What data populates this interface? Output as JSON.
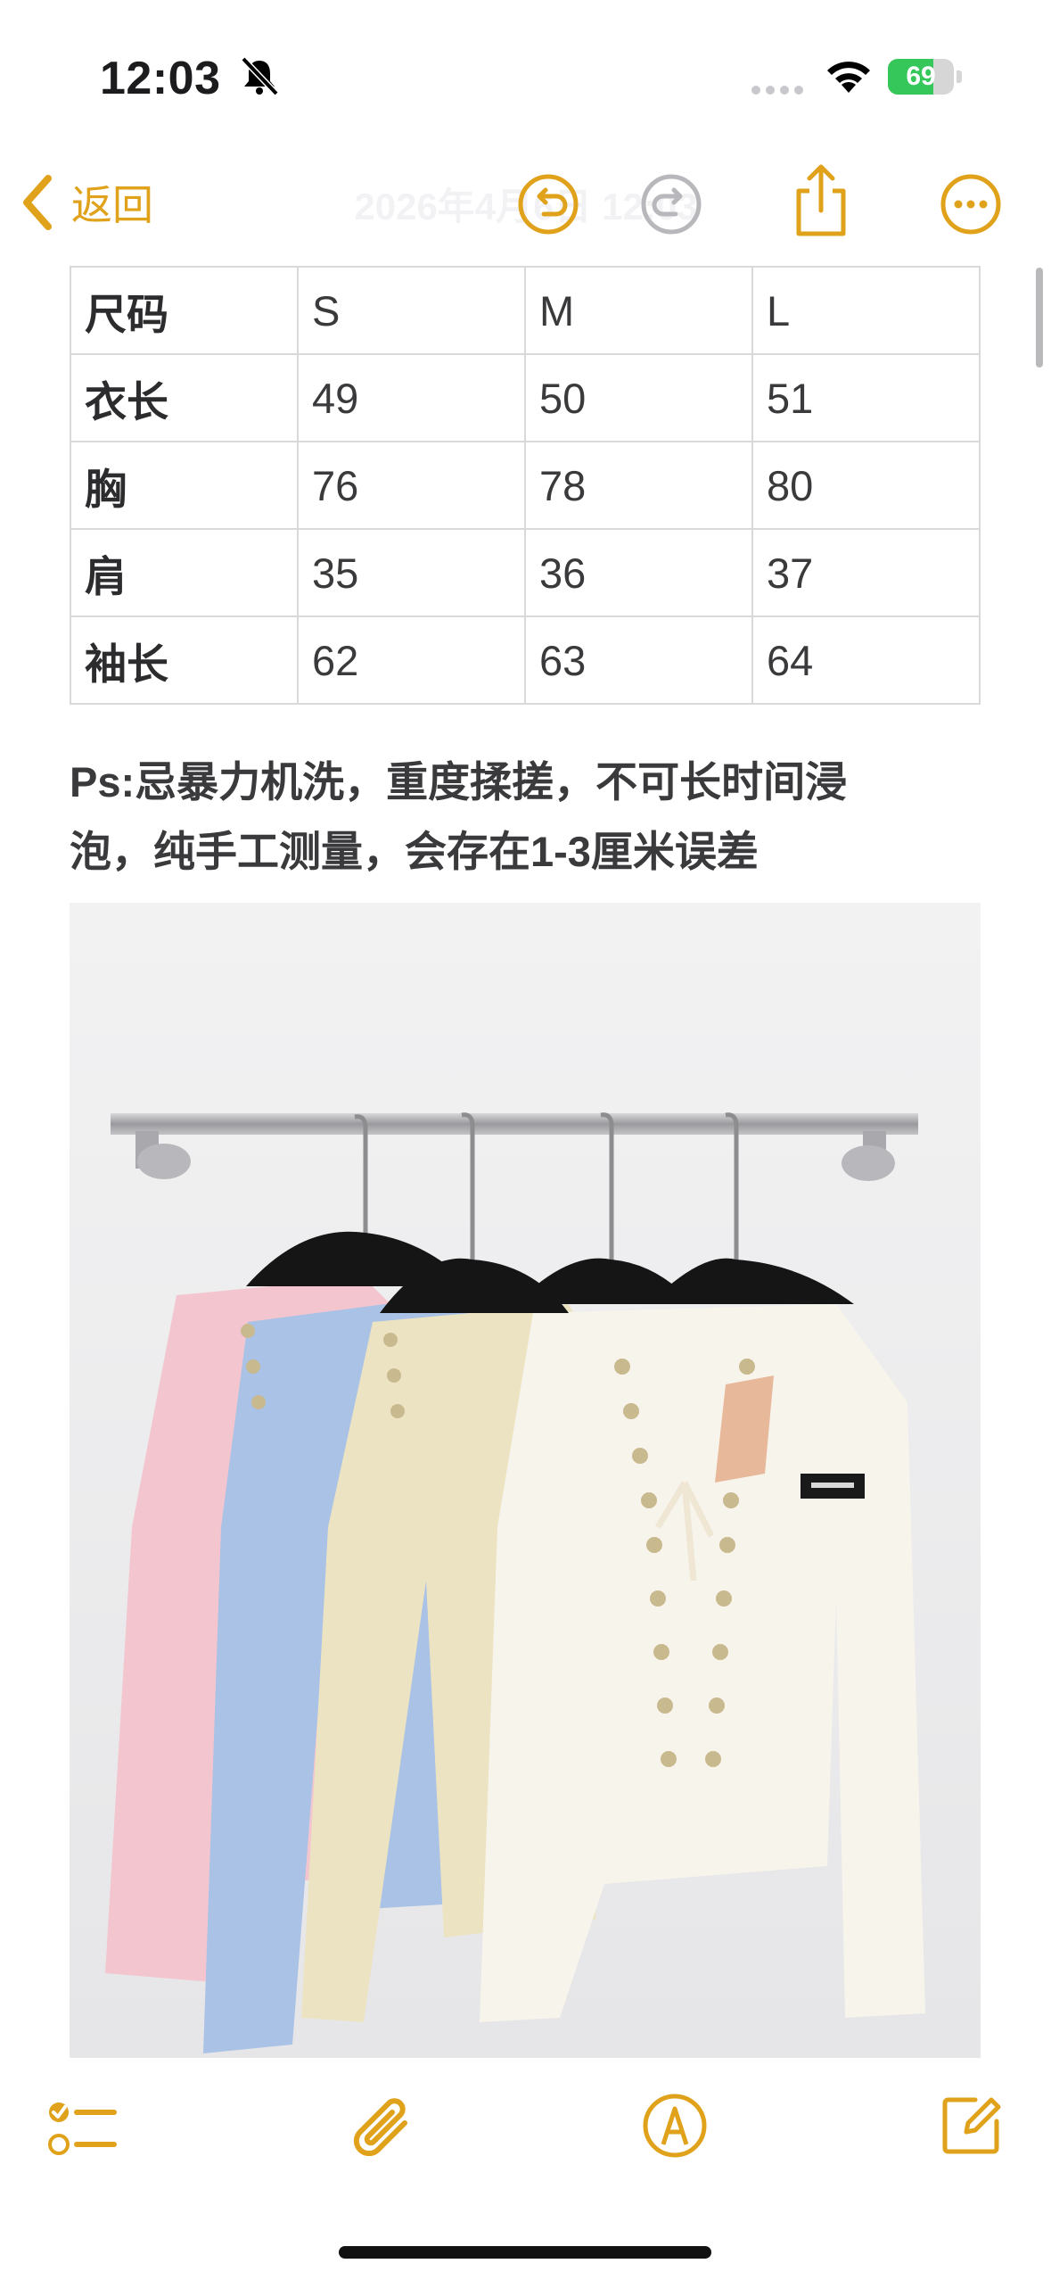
{
  "status_bar": {
    "time": "12:03",
    "battery_level": 69,
    "battery_label": "69",
    "icons": [
      "bell-slash-icon",
      "cellular-signal-icon",
      "wifi-icon",
      "battery-charging-icon"
    ]
  },
  "nav_bar": {
    "back_label": "返回",
    "title": "2026年4月6日 12:03",
    "icons": [
      "chevron-left-icon",
      "undo-icon",
      "redo-icon",
      "share-icon",
      "more-icon"
    ]
  },
  "size_table": {
    "rows": [
      [
        "尺码",
        "S",
        "M",
        "L"
      ],
      [
        "衣长",
        "49",
        "50",
        "51"
      ],
      [
        "胸",
        "76",
        "78",
        "80"
      ],
      [
        "肩",
        "35",
        "36",
        "37"
      ],
      [
        "袖长",
        "62",
        "63",
        "64"
      ]
    ]
  },
  "note": {
    "line1": "Ps:忌暴力机洗，重度揉搓，不可长时间浸",
    "line2": "泡，纯手工测量，会存在1-3厘米误差"
  },
  "photo": {
    "icon": "product-photo-cardigans",
    "cardigan_colors": [
      "#f3c6cf",
      "#a9c2e6",
      "#ece3c2",
      "#f7f4ec"
    ]
  },
  "toolbar": {
    "icons": [
      "checklist-icon",
      "paperclip-icon",
      "markup-pen-icon",
      "compose-icon"
    ]
  },
  "colors": {
    "accent": "#e0a11b",
    "disabled": "#b8b8bc",
    "table_border": "#d9d9dc"
  }
}
